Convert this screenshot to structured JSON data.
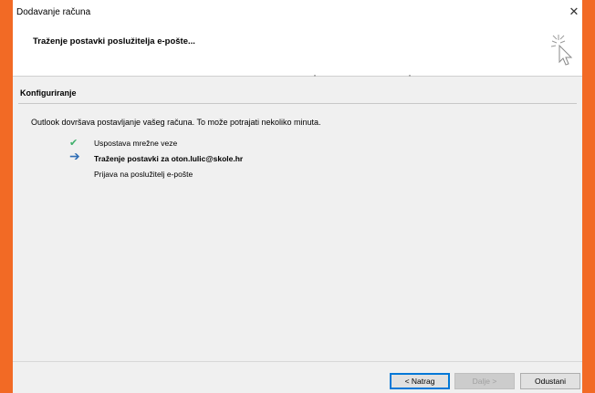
{
  "window": {
    "title": "Dodavanje računa",
    "close_glyph": "✕"
  },
  "header": {
    "heading": "Traženje postavki poslužitelja e-pošte...",
    "icon": "sparkle-cursor-icon"
  },
  "section": {
    "title": "Konfiguriranje",
    "intro": "Outlook dovršava postavljanje vašeg računa. To može potrajati nekoliko minuta."
  },
  "steps": [
    {
      "icon": "check-icon",
      "glyph": "✔",
      "label": "Uspostava mrežne veze",
      "state": "done"
    },
    {
      "icon": "arrow-right-icon",
      "glyph": "➔",
      "label": "Traženje postavki za oton.lulic@skole.hr",
      "state": "active"
    },
    {
      "icon": "",
      "glyph": "",
      "label": "Prijava na poslužitelj e-pošte",
      "state": "pending"
    }
  ],
  "buttons": {
    "back": "< Natrag",
    "next": "Dalje >",
    "cancel": "Odustani"
  },
  "colors": {
    "background": "#F26A25",
    "check": "#3FAF6A",
    "arrow": "#2F6EB5",
    "focus": "#0078D7"
  }
}
